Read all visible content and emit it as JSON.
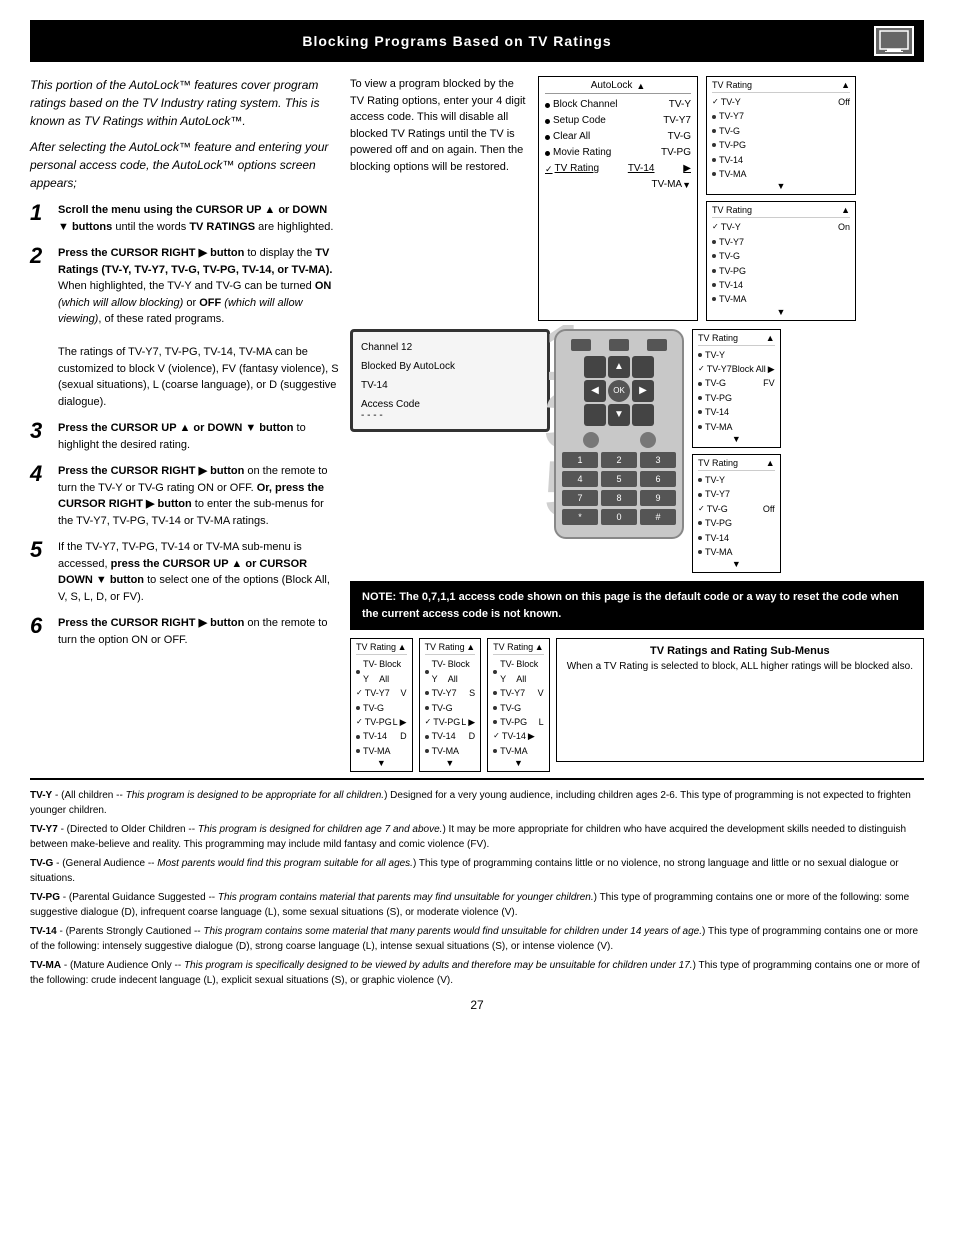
{
  "page": {
    "title": "Blocking Programs Based on TV Ratings",
    "page_number": "27",
    "title_icon": "📺"
  },
  "intro": {
    "italic_text": "This portion of the AutoLock™ features cover program ratings based on the TV Industry rating system. This is known as TV Ratings within AutoLock™.",
    "italic_text2": "After selecting the AutoLock™ feature and entering your personal access code, the AutoLock™ options screen appears;"
  },
  "steps": [
    {
      "number": "1",
      "text_bold": "Scroll the menu using the CURSOR UP ▲ or DOWN ▼ buttons",
      "text_normal": " until the words ",
      "text_bold2": "TV RATINGS",
      "text_end": " are highlighted."
    },
    {
      "number": "2",
      "text_bold": "Press the CURSOR RIGHT ▶ button",
      "text_normal": " to display the ",
      "text_bold2": "TV Ratings (TV-Y, TV-Y7, TV-G, TV-PG, TV-14, or TV-MA).",
      "text_end": " When highlighted, the TV-Y and TV-G can be turned ON (which will allow blocking) or OFF (which will allow viewing), of these rated programs.\n\nThe ratings of TV-Y7, TV-PG, TV-14, TV-MA can be customized to block V (violence), FV (fantasy violence), S (sexual situations), L (coarse language), or D (suggestive dialogue)."
    },
    {
      "number": "3",
      "text_bold": "Press the CURSOR UP ▲ or DOWN ▼ button",
      "text_normal": " to highlight the desired rating."
    },
    {
      "number": "4",
      "text_bold": "Press the CURSOR RIGHT ▶ button",
      "text_normal": " on the remote to turn the TV-Y or TV-G rating ON or OFF. ",
      "text_bold2": "Or, press the CURSOR RIGHT ▶ button",
      "text_end": " to enter the sub-menus for the TV-Y7, TV-PG, TV-14 or TV-MA ratings."
    },
    {
      "number": "5",
      "text_normal": "If the TV-Y7, TV-PG, TV-14 or TV-MA sub-menu is accessed, ",
      "text_bold": "press the CURSOR UP ▲ or CURSOR DOWN ▼ button",
      "text_end": " to select one of the options (Block All, V, S, L, D, or FV)."
    },
    {
      "number": "6",
      "text_bold": "Press the CURSOR RIGHT ▶ button",
      "text_normal": " on the remote to turn the option ON or OFF."
    }
  ],
  "description_box": {
    "text": "To view a program blocked by the TV Rating options, enter your 4 digit access code. This will disable all blocked TV Ratings until the TV is powered off and on again. Then the blocking options will be restored."
  },
  "autolock_menu": {
    "title": "AutoLock",
    "items": [
      {
        "label": "Block Channel",
        "value": "TV-Y",
        "selected": false
      },
      {
        "label": "Setup Code",
        "value": "TV-Y7",
        "selected": false
      },
      {
        "label": "Clear All",
        "value": "TV-G",
        "selected": false
      },
      {
        "label": "Movie Rating",
        "value": "TV-PG",
        "selected": false
      },
      {
        "label": "TV Rating",
        "value": "TV-14",
        "selected": true,
        "has_arrow": true
      },
      {
        "label": "",
        "value": "TV-MA",
        "selected": false
      }
    ]
  },
  "tv_screen": {
    "line1": "Channel 12",
    "line2": "Blocked By AutoLock",
    "line3": "TV-14",
    "access_label": "Access Code",
    "access_value": "- - - -"
  },
  "note_box": {
    "text": "NOTE: The 0,7,1,1 access code shown on this page is the default code or a way to reset the code when the current access code is not known."
  },
  "side_panels": [
    {
      "title": "TV Rating",
      "title_arrow": "▲",
      "items": [
        {
          "label": "TV-Y",
          "value": "Off",
          "checked": true
        },
        {
          "label": "TV-Y7",
          "value": ""
        },
        {
          "label": "TV-G",
          "value": ""
        },
        {
          "label": "TV-PG",
          "value": ""
        },
        {
          "label": "TV-14",
          "value": ""
        },
        {
          "label": "TV-MA",
          "value": ""
        }
      ]
    },
    {
      "title": "TV Rating",
      "title_arrow": "▲",
      "items": [
        {
          "label": "TV-Y",
          "value": "On",
          "checked": true
        },
        {
          "label": "TV-Y7",
          "value": ""
        },
        {
          "label": "TV-G",
          "value": ""
        },
        {
          "label": "TV-PG",
          "value": ""
        },
        {
          "label": "TV-14",
          "value": ""
        },
        {
          "label": "TV-MA",
          "value": ""
        }
      ]
    },
    {
      "title": "TV Rating",
      "title_arrow": "▲",
      "items": [
        {
          "label": "TV-Y",
          "value": ""
        },
        {
          "label": "TV-Y7",
          "value": "Block All",
          "checked": true,
          "has_arrow": true
        },
        {
          "label": "TV-G",
          "value": "FV"
        },
        {
          "label": "TV-PG",
          "value": ""
        },
        {
          "label": "TV-14",
          "value": ""
        },
        {
          "label": "TV-MA",
          "value": ""
        }
      ]
    },
    {
      "title": "TV Rating",
      "title_arrow": "▲",
      "items": [
        {
          "label": "TV-Y",
          "value": ""
        },
        {
          "label": "TV-Y7",
          "value": ""
        },
        {
          "label": "TV-G",
          "value": "Off",
          "checked": true
        },
        {
          "label": "TV-PG",
          "value": ""
        },
        {
          "label": "TV-14",
          "value": ""
        },
        {
          "label": "TV-MA",
          "value": ""
        }
      ]
    }
  ],
  "bottom_rating_menus": [
    {
      "title": "TV Rating",
      "items": [
        {
          "label": "TV-Y",
          "value": "Block All"
        },
        {
          "label": "TV-Y7",
          "value": "V",
          "checked": true
        },
        {
          "label": "TV-G",
          "value": ""
        },
        {
          "label": "TV-PG",
          "value": "L",
          "checked": true,
          "has_arrow": true
        },
        {
          "label": "TV-14",
          "value": "D"
        },
        {
          "label": "TV-MA",
          "value": ""
        }
      ]
    },
    {
      "title": "TV Rating",
      "items": [
        {
          "label": "TV-Y",
          "value": "Block All"
        },
        {
          "label": "TV-Y7",
          "value": "S"
        },
        {
          "label": "TV-G",
          "value": ""
        },
        {
          "label": "TV-PG",
          "value": "L",
          "checked": true,
          "has_arrow": true
        },
        {
          "label": "TV-14",
          "value": "D"
        },
        {
          "label": "TV-MA",
          "value": ""
        }
      ]
    },
    {
      "title": "TV Rating",
      "items": [
        {
          "label": "TV-Y",
          "value": "Block All"
        },
        {
          "label": "TV-Y7",
          "value": "V"
        },
        {
          "label": "TV-G",
          "value": ""
        },
        {
          "label": "TV-PG",
          "value": "L"
        },
        {
          "label": "TV-14",
          "value": "",
          "checked": true,
          "has_arrow": true
        },
        {
          "label": "TV-MA",
          "value": ""
        }
      ]
    }
  ],
  "caption": {
    "title": "TV Ratings and Rating Sub-Menus",
    "text": "When a TV Rating is selected to block, ALL higher ratings will be blocked also."
  },
  "footnotes": [
    {
      "label": "TV-Y",
      "text": " - (All children -- This program is designed to be appropriate for all children.) Designed for a very young audience, including children ages 2-6. This type of programming is not expected to frighten younger children."
    },
    {
      "label": "TV-Y7",
      "text": " - (Directed to Older Children -- This program is designed for children age 7 and above.) It may be more appropriate for children who have acquired the development skills needed to distinguish between make-believe and reality. This programming may include mild fantasy and comic violence (FV)."
    },
    {
      "label": "TV-G",
      "text": " - (General Audience -- Most parents would find this program suitable for all ages.) This type of programming contains little or no violence, no strong language and little or no sexual dialogue or situations."
    },
    {
      "label": "TV-PG",
      "text": " - (Parental Guidance Suggested -- This program contains material that parents may find unsuitable for younger children.) This type of programming contains one or more of the following: some suggestive dialogue (D), infrequent coarse language (L), some sexual situations (S), or moderate violence (V)."
    },
    {
      "label": "TV-14",
      "text": " - (Parents Strongly Cautioned -- This program contains some material that many parents would find unsuitable for children under 14 years of age.) This type of programming contains one or more of the following: intensely suggestive dialogue (D), strong coarse language (L), intense sexual situations (S), or intense violence (V)."
    },
    {
      "label": "TV-MA",
      "text": " - (Mature Audience Only -- This program is specifically designed to be viewed by adults and therefore may be unsuitable for children under 17.) This type of programming contains one or more of the following: crude indecent language (L), explicit sexual situations (S), or graphic violence (V)."
    }
  ]
}
